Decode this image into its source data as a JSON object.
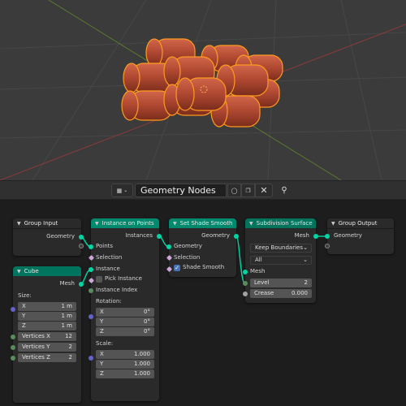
{
  "header": {
    "tree_name": "Geometry Nodes",
    "editor_type_icon": "node-tree-icon",
    "fake_user_icon": "shield-icon",
    "duplicate_icon": "duplicate-icon",
    "close_icon": "x-icon",
    "pin_icon": "pin-icon"
  },
  "nodes": {
    "group_input": {
      "title": "Group Input",
      "outputs": [
        "Geometry"
      ]
    },
    "cube": {
      "title": "Cube",
      "output": "Mesh",
      "size_label": "Size:",
      "size": [
        {
          "axis": "X",
          "value": "1 m"
        },
        {
          "axis": "Y",
          "value": "1 m"
        },
        {
          "axis": "Z",
          "value": "1 m"
        }
      ],
      "vertices": [
        {
          "label": "Vertices X",
          "value": "12"
        },
        {
          "label": "Vertices Y",
          "value": "2"
        },
        {
          "label": "Vertices Z",
          "value": "2"
        }
      ]
    },
    "instance_on_points": {
      "title": "Instance on Points",
      "output": "Instances",
      "inputs": {
        "points": "Points",
        "selection": "Selection",
        "instance": "Instance",
        "pick_instance": "Pick Instance",
        "instance_index": "Instance Index"
      },
      "rotation_label": "Rotation:",
      "rotation": [
        {
          "axis": "X",
          "value": "0°"
        },
        {
          "axis": "Y",
          "value": "0°"
        },
        {
          "axis": "Z",
          "value": "0°"
        }
      ],
      "scale_label": "Scale:",
      "scale": [
        {
          "axis": "X",
          "value": "1.000"
        },
        {
          "axis": "Y",
          "value": "1.000"
        },
        {
          "axis": "Z",
          "value": "1.000"
        }
      ]
    },
    "set_shade_smooth": {
      "title": "Set Shade Smooth",
      "output": "Geometry",
      "inputs": {
        "geometry": "Geometry",
        "selection": "Selection",
        "shade_smooth": "Shade Smooth"
      },
      "shade_smooth_checked": true
    },
    "subdivision_surface": {
      "title": "Subdivision Surface",
      "output": "Mesh",
      "boundary": "Keep Boundaries",
      "uv_smooth": "All",
      "input_mesh": "Mesh",
      "level_label": "Level",
      "level_value": "2",
      "crease_label": "Crease",
      "crease_value": "0.000"
    },
    "group_output": {
      "title": "Group Output",
      "inputs": [
        "Geometry"
      ]
    }
  },
  "colors": {
    "geometry_header": "#00896c",
    "mesh_header": "#00745c",
    "geometry_socket": "#00d6a3",
    "vector_socket": "#6363c7",
    "object_color": "#b84a32",
    "selection_outline": "#ff9a1f"
  }
}
